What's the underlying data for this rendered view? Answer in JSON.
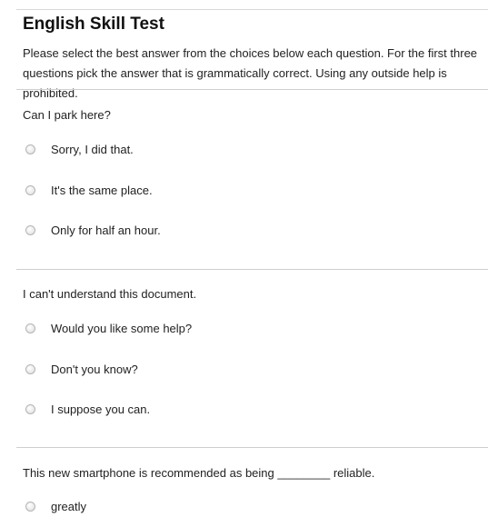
{
  "header": {
    "title": "English Skill Test",
    "intro": "Please select the best answer from the choices below each question. For the first three questions pick the answer that is grammatically correct. Using any outside help is prohibited."
  },
  "questions": [
    {
      "prompt": "Can I park here?",
      "options": [
        "Sorry, I did that.",
        "It's the same place.",
        "Only for half an hour."
      ]
    },
    {
      "prompt": "I can't understand this document.",
      "options": [
        "Would you like some help?",
        "Don't you know?",
        "I suppose you can."
      ]
    },
    {
      "prompt": "This new smartphone is recommended as being ________ reliable.",
      "options": [
        "greatly"
      ]
    }
  ]
}
